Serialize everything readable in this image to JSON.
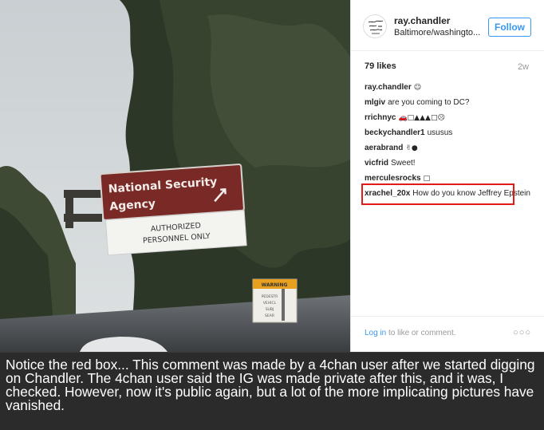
{
  "post": {
    "username": "ray.chandler",
    "location": "Baltimore/washingto...",
    "follow_label": "Follow",
    "likes": "79 likes",
    "age": "2w",
    "comments": [
      {
        "user": "ray.chandler",
        "text": "",
        "emoji": "☺"
      },
      {
        "user": "mlgiv",
        "text": "are you coming to DC?",
        "emoji": ""
      },
      {
        "user": "rrichnyc",
        "text": "",
        "emoji": "🚗□▲▲▲□☹"
      },
      {
        "user": "beckychandler1",
        "text": "ususus",
        "emoji": ""
      },
      {
        "user": "aerabrand",
        "text": "",
        "emoji": "✌●"
      },
      {
        "user": "vicfrid",
        "text": "Sweet!",
        "emoji": ""
      },
      {
        "user": "merculesrocks",
        "text": "",
        "emoji": "□"
      },
      {
        "user": "xrachel_20x",
        "text": "How do you know Jeffrey Epstein",
        "emoji": ""
      }
    ],
    "login_link": "Log in",
    "login_rest": " to like or comment.",
    "more_icon": "more-dots-icon"
  },
  "sign": {
    "main_line1": "National Security",
    "main_line2": "Agency",
    "sub_line1": "AUTHORIZED",
    "sub_line2": "PERSONNEL ONLY",
    "warning_title": "WARNING",
    "warning_lines": [
      "PEDESTR",
      "VEHICL",
      "SUBJ",
      "SEAR"
    ]
  },
  "caption": "Notice the red box... This comment was made by a 4chan user after we started digging on Chandler. The 4chan user said the IG was made private after this, and it was, I checked. However, now it's public again, but a lot of the more implicating pictures have vanished.",
  "colors": {
    "follow_blue": "#3897f0",
    "highlight_red": "#e31a1a",
    "sign_maroon": "#7a2a26"
  }
}
